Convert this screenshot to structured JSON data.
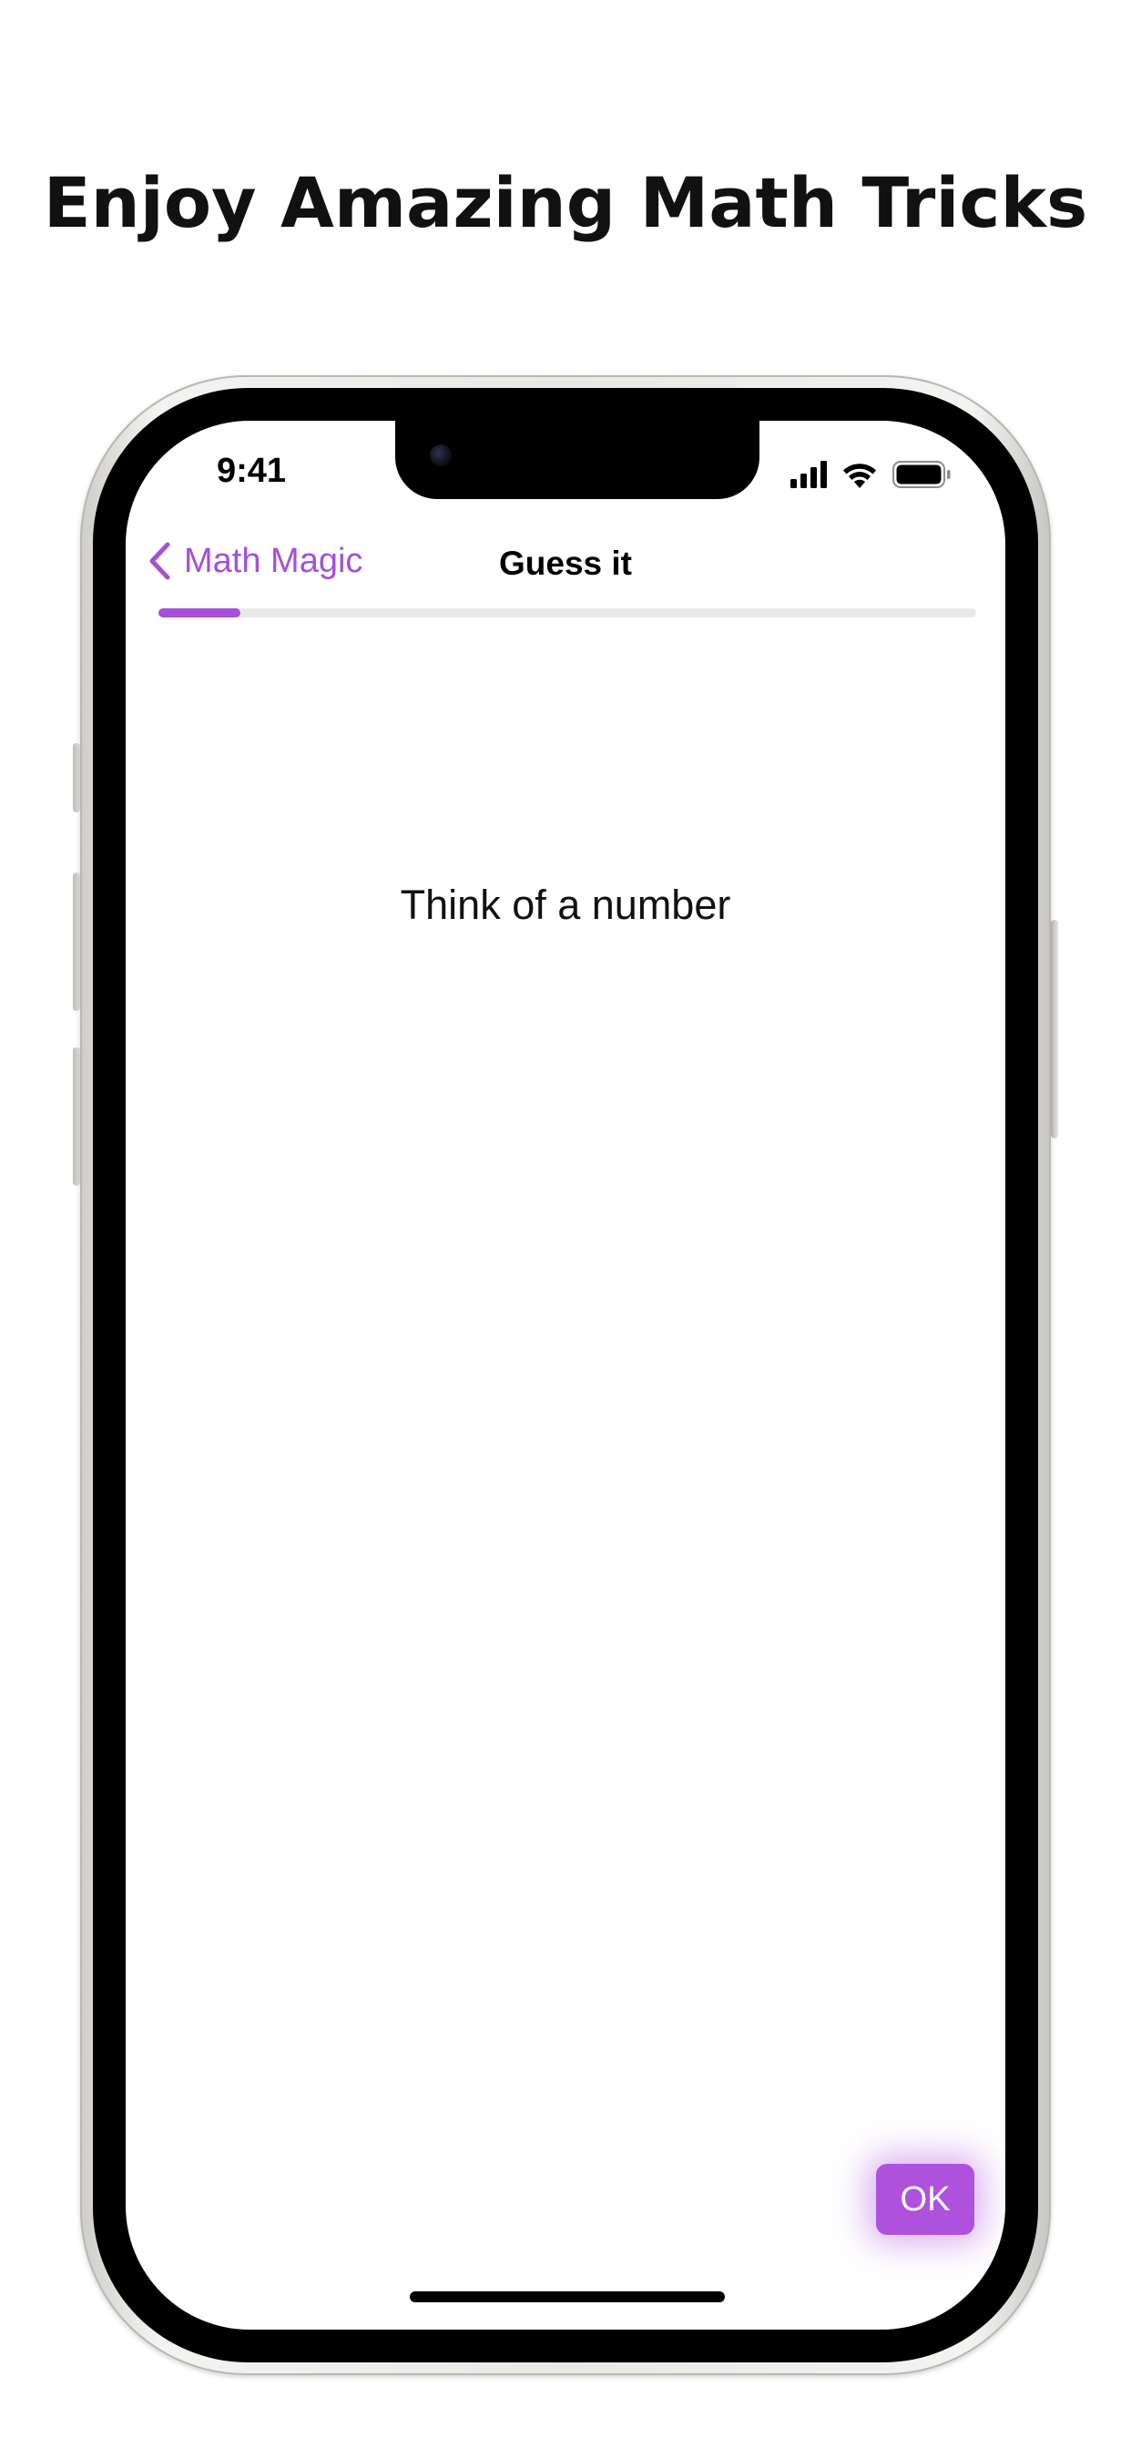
{
  "headline": "Enjoy Amazing Math Tricks",
  "status_bar": {
    "time": "9:41",
    "icons": [
      "cellular-signal-icon",
      "wifi-icon",
      "battery-icon"
    ]
  },
  "nav": {
    "back_label": "Math Magic",
    "back_icon": "chevron-left-icon",
    "title": "Guess it"
  },
  "progress": {
    "fraction": 0.1
  },
  "prompt": "Think of a number",
  "ok_button": {
    "label": "OK"
  },
  "colors": {
    "accent": "#a550d8",
    "button": "#ae52de",
    "track": "#e8e8e8"
  }
}
